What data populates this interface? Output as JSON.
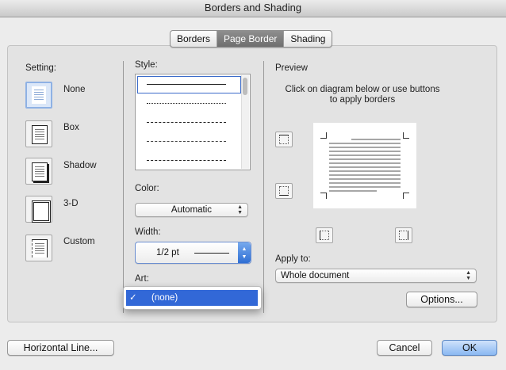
{
  "window": {
    "title": "Borders and Shading"
  },
  "tabs": [
    {
      "label": "Borders",
      "active": false
    },
    {
      "label": "Page Border",
      "active": true
    },
    {
      "label": "Shading",
      "active": false
    }
  ],
  "setting": {
    "label": "Setting:",
    "options": [
      {
        "label": "None",
        "selected": true
      },
      {
        "label": "Box",
        "selected": false
      },
      {
        "label": "Shadow",
        "selected": false
      },
      {
        "label": "3-D",
        "selected": false
      },
      {
        "label": "Custom",
        "selected": false
      }
    ]
  },
  "style": {
    "label": "Style:"
  },
  "color": {
    "label": "Color:",
    "value": "Automatic"
  },
  "width": {
    "label": "Width:",
    "value": "1/2 pt"
  },
  "art": {
    "label": "Art:",
    "menu_selected": "(none)",
    "checkmark": "✓"
  },
  "preview": {
    "label": "Preview",
    "instruction_line1": "Click on diagram below or use buttons",
    "instruction_line2": "to apply borders"
  },
  "apply_to": {
    "label": "Apply to:",
    "value": "Whole document"
  },
  "buttons": {
    "options": "Options...",
    "horizontal_line": "Horizontal Line...",
    "cancel": "Cancel",
    "ok": "OK"
  },
  "colors": {
    "accent": "#3268d7",
    "selected_setting": "#8eb1e4"
  }
}
